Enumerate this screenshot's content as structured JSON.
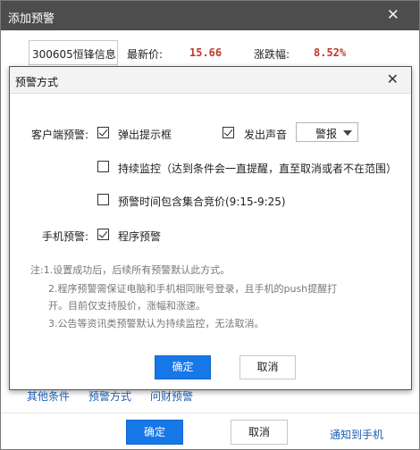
{
  "outer": {
    "title": "添加预警",
    "close": "✕",
    "stock": "300605恒锋信息",
    "latest_price_label": "最新价:",
    "latest_price": "15.66",
    "change_label": "涨跌幅:",
    "change": "8.52%",
    "links": [
      "其他条件",
      "预警方式",
      "问财预警"
    ],
    "confirm": "确定",
    "cancel": "取消",
    "notify_phone": "通知到手机"
  },
  "dialog": {
    "title": "预警方式",
    "close": "✕",
    "client_label": "客户端预警:",
    "popup": "弹出提示框",
    "sound": "发出声音",
    "sound_option": "警报",
    "continuous": "持续监控（达到条件会一直提醒，直至取消或者不在范围）",
    "auction": "预警时间包含集合竞价(9:15-9:25)",
    "phone_label": "手机预警:",
    "program": "程序预警",
    "notes": [
      "注:1.设置成功后，后续所有预警默认此方式。",
      "2.程序预警需保证电脑和手机相同账号登录，且手机的push提醒打",
      "开。目前仅支持股价，涨幅和涨速。",
      "3.公告等资讯类预警默认为持续监控，无法取消。"
    ],
    "confirm": "确定",
    "cancel": "取消"
  },
  "colors": {
    "accent": "#1677e6",
    "price_red": "#c0392b",
    "titlebar": "#4d4d4d"
  }
}
